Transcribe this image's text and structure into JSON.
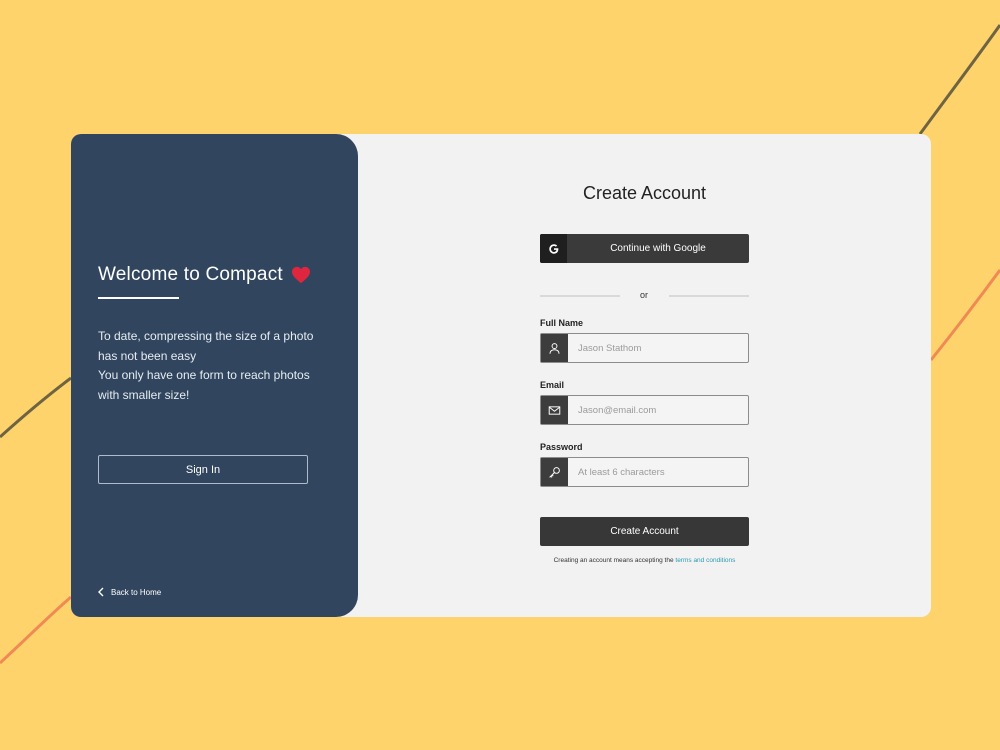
{
  "colors": {
    "background": "#FFD36B",
    "panel_left": "#31465E",
    "panel_right": "#F2F2F2",
    "accent_heart": "#E0263F",
    "button_dark": "#373737",
    "link": "#2A9BB5"
  },
  "icons": {
    "heart": "heart-icon",
    "back": "chevron-left-icon",
    "google": "google-icon",
    "full_name": "user-icon",
    "email": "mail-icon",
    "password": "key-icon"
  },
  "left_panel": {
    "welcome_title": "Welcome to Compact",
    "tagline_lines": [
      "To date, compressing the size of a photo",
      "has not been easy",
      "You only have one form to reach photos",
      "with smaller size!"
    ],
    "signin_label": "Sign In",
    "back_label": "Back to Home"
  },
  "form": {
    "title": "Create Account",
    "google_label": "Continue with Google",
    "divider_text": "or",
    "full_name": {
      "label": "Full Name",
      "placeholder": "Jason Stathom",
      "value": ""
    },
    "email": {
      "label": "Email",
      "placeholder": "Jason@email.com",
      "value": ""
    },
    "password": {
      "label": "Password",
      "placeholder": "At least 6 characters",
      "value": ""
    },
    "submit_label": "Create Account",
    "terms_prefix": "Creating an account means accepting the ",
    "terms_link": "terms and conditions"
  }
}
